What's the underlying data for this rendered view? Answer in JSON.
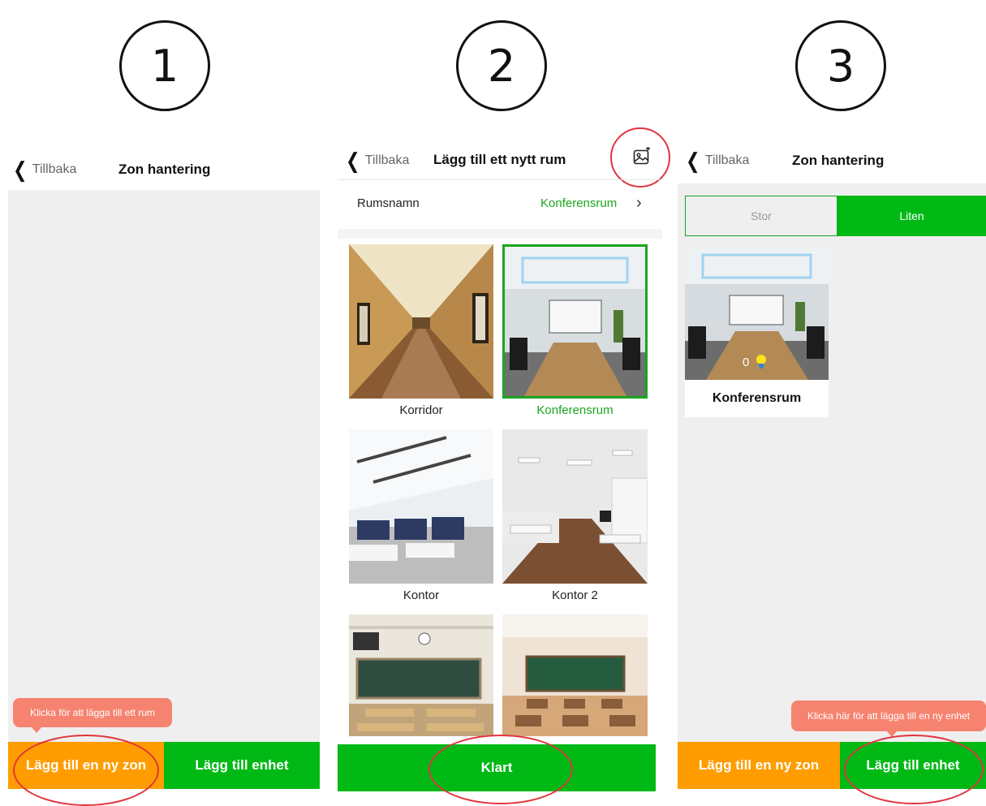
{
  "steps": [
    "1",
    "2",
    "3"
  ],
  "colors": {
    "green": "#00b915",
    "orange": "#ff9d00",
    "tooltip": "#f6836f",
    "highlight": "#e0343d"
  },
  "screen1": {
    "back_label": "Tillbaka",
    "title": "Zon hantering",
    "tooltip": "Klicka för att lägga till ett rum",
    "add_zone_label": "Lägg till en ny zon",
    "add_device_label": "Lägg till enhet"
  },
  "screen2": {
    "back_label": "Tillbaka",
    "title": "Lägg till ett nytt rum",
    "image_icon": "image-upload-icon",
    "room_name_label": "Rumsnamn",
    "room_name_value": "Konferensrum",
    "rooms": [
      {
        "label": "Korridor",
        "selected": false
      },
      {
        "label": "Konferensrum",
        "selected": true
      },
      {
        "label": "Kontor",
        "selected": false
      },
      {
        "label": "Kontor 2",
        "selected": false
      },
      {
        "label": "",
        "selected": false
      },
      {
        "label": "",
        "selected": false
      }
    ],
    "done_label": "Klart"
  },
  "screen3": {
    "back_label": "Tillbaka",
    "title": "Zon hantering",
    "toggle_large": "Stor",
    "toggle_small": "Liten",
    "room_card_label": "Konferensrum",
    "room_card_count": "0",
    "tooltip": "Klicka här för att lägga till en ny enhet",
    "add_zone_label": "Lägg till en ny zon",
    "add_device_label": "Lägg till enhet"
  }
}
